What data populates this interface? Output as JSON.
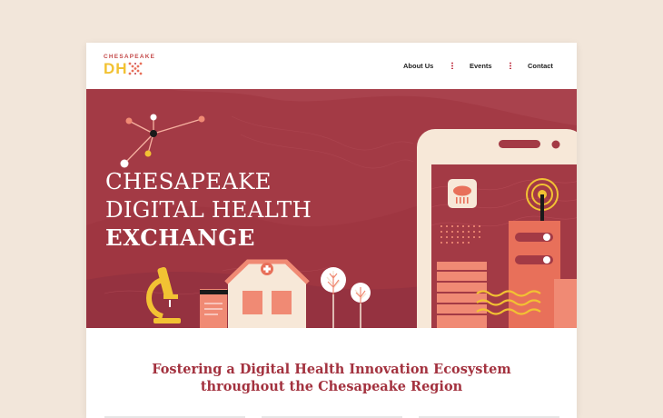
{
  "logo": {
    "small": "CHESAPEAKE",
    "big": "DH"
  },
  "nav": {
    "about": "About Us",
    "events": "Events",
    "contact": "Contact"
  },
  "hero": {
    "line1": "CHESAPEAKE",
    "line2": "DIGITAL HEALTH",
    "line3": "EXCHANGE"
  },
  "tagline": {
    "line1": "Fostering a Digital Health Innovation Ecosystem",
    "line2": "throughout the Chesapeake Region"
  },
  "colors": {
    "background": "#f2e6da",
    "hero": "#a33a45",
    "accent_red": "#c23a4a",
    "accent_yellow": "#f2c233",
    "accent_coral": "#e8705a"
  }
}
